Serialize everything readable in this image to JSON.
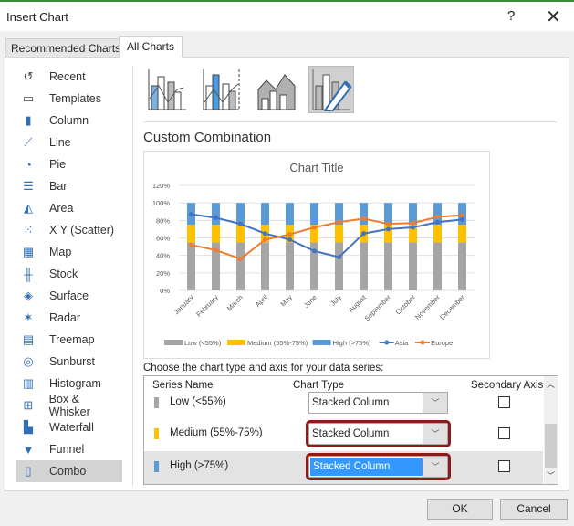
{
  "dialog": {
    "title": "Insert Chart",
    "help": "?",
    "close": "✕"
  },
  "tabs": [
    {
      "label": "Recommended Charts"
    },
    {
      "label": "All Charts",
      "active": true
    }
  ],
  "sidebar": {
    "items": [
      {
        "label": "Recent",
        "icon": "recent-icon"
      },
      {
        "label": "Templates",
        "icon": "folder-icon"
      },
      {
        "label": "Column",
        "icon": "column-chart-icon"
      },
      {
        "label": "Line",
        "icon": "line-chart-icon"
      },
      {
        "label": "Pie",
        "icon": "pie-chart-icon"
      },
      {
        "label": "Bar",
        "icon": "bar-chart-icon"
      },
      {
        "label": "Area",
        "icon": "area-chart-icon"
      },
      {
        "label": "X Y (Scatter)",
        "icon": "scatter-chart-icon"
      },
      {
        "label": "Map",
        "icon": "map-chart-icon"
      },
      {
        "label": "Stock",
        "icon": "stock-chart-icon"
      },
      {
        "label": "Surface",
        "icon": "surface-chart-icon"
      },
      {
        "label": "Radar",
        "icon": "radar-chart-icon"
      },
      {
        "label": "Treemap",
        "icon": "treemap-chart-icon"
      },
      {
        "label": "Sunburst",
        "icon": "sunburst-chart-icon"
      },
      {
        "label": "Histogram",
        "icon": "histogram-chart-icon"
      },
      {
        "label": "Box & Whisker",
        "icon": "box-whisker-chart-icon"
      },
      {
        "label": "Waterfall",
        "icon": "waterfall-chart-icon"
      },
      {
        "label": "Funnel",
        "icon": "funnel-chart-icon"
      },
      {
        "label": "Combo",
        "icon": "combo-chart-icon",
        "selected": true
      }
    ]
  },
  "section_title": "Custom Combination",
  "chart_data": {
    "type": "bar",
    "title": "Chart Title",
    "categories": [
      "January",
      "February",
      "March",
      "April",
      "May",
      "June",
      "July",
      "August",
      "September",
      "October",
      "November",
      "December"
    ],
    "ylim": [
      0,
      1.2
    ],
    "yticks": [
      "0%",
      "20%",
      "40%",
      "60%",
      "80%",
      "100%",
      "120%"
    ],
    "grid": true,
    "legend": "bottom",
    "series": [
      {
        "name": "Low (<55%)",
        "type": "stacked-column",
        "color": "#a5a5a5",
        "values": [
          0.55,
          0.55,
          0.55,
          0.55,
          0.55,
          0.55,
          0.55,
          0.55,
          0.55,
          0.55,
          0.55,
          0.55
        ]
      },
      {
        "name": "Medium (55%-75%)",
        "type": "stacked-column",
        "color": "#ffc000",
        "values": [
          0.2,
          0.2,
          0.2,
          0.2,
          0.2,
          0.2,
          0.2,
          0.2,
          0.2,
          0.2,
          0.2,
          0.2
        ]
      },
      {
        "name": "High (>75%)",
        "type": "stacked-column",
        "color": "#5b9bd5",
        "values": [
          0.25,
          0.25,
          0.25,
          0.25,
          0.25,
          0.25,
          0.25,
          0.25,
          0.25,
          0.25,
          0.25,
          0.25
        ]
      },
      {
        "name": "Asia",
        "type": "line",
        "color": "#4472c4",
        "values": [
          0.87,
          0.83,
          0.76,
          0.65,
          0.58,
          0.45,
          0.38,
          0.65,
          0.7,
          0.72,
          0.78,
          0.81
        ]
      },
      {
        "name": "Europe",
        "type": "line",
        "color": "#ed7d31",
        "values": [
          0.52,
          0.46,
          0.36,
          0.58,
          0.64,
          0.72,
          0.78,
          0.82,
          0.76,
          0.77,
          0.84,
          0.86
        ]
      }
    ]
  },
  "series_table": {
    "prompt": "Choose the chart type and axis for your data series:",
    "headers": {
      "name": "Series Name",
      "type": "Chart Type",
      "axis": "Secondary Axis"
    },
    "rows": [
      {
        "name": "Low (<55%)",
        "color": "#a5a5a5",
        "type": "Stacked Column",
        "secondary": false
      },
      {
        "name": "Medium (55%-75%)",
        "color": "#ffc000",
        "type": "Stacked Column",
        "secondary": false
      },
      {
        "name": "High (>75%)",
        "color": "#5b9bd5",
        "type": "Stacked Column",
        "secondary": false
      }
    ]
  },
  "buttons": {
    "ok": "OK",
    "cancel": "Cancel"
  }
}
